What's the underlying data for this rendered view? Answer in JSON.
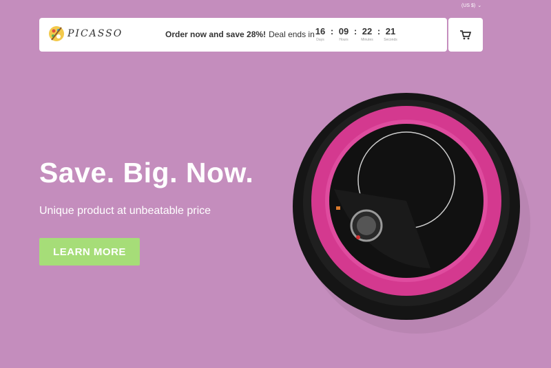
{
  "header": {
    "currency": "(US $)",
    "logo_text": "PICASSO",
    "promo_bold": "Order now and save 28%!",
    "promo_text": "Deal ends in",
    "countdown": [
      {
        "value": "16",
        "label": "Days"
      },
      {
        "value": "09",
        "label": "Hours"
      },
      {
        "value": "22",
        "label": "Minutes"
      },
      {
        "value": "21",
        "label": "Seconds"
      }
    ],
    "cart_icon": "cart-icon"
  },
  "hero": {
    "title": "Save. Big. Now.",
    "subtitle": "Unique product at unbeatable price",
    "cta_label": "LEARN MORE"
  },
  "colors": {
    "background": "#c48dbd",
    "cta": "#a6dd78",
    "robot_accent": "#d4398f"
  }
}
